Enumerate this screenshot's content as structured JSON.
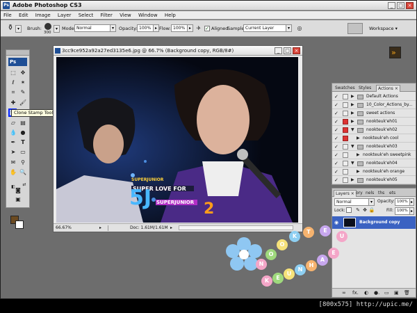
{
  "app": {
    "title": "Adobe Photoshop CS3",
    "logo": "Ps"
  },
  "window_controls": [
    "_",
    "□",
    "×"
  ],
  "menu": [
    "File",
    "Edit",
    "Image",
    "Layer",
    "Select",
    "Filter",
    "View",
    "Window",
    "Help"
  ],
  "options": {
    "brush_label": "Brush:",
    "brush_size": "300",
    "mode_label": "Mode:",
    "mode_value": "Normal",
    "opacity_label": "Opacity:",
    "opacity_value": "100%",
    "flow_label": "Flow:",
    "flow_value": "100%",
    "aligned_label": "Aligned",
    "sample_label": "Sample:",
    "sample_value": "Current Layer",
    "workspace_label": "Workspace ▾"
  },
  "toolbox": {
    "logo": "Ps",
    "tooltip": "Clone Stamp Tool (S)",
    "fg_color": "#6b4a21",
    "bg_color": "#ffffff"
  },
  "document": {
    "title": "3cc9ce952a92a27ed3135e6.jpg @ 66.7% (Background copy, RGB/8#)",
    "zoom": "66.67%",
    "doc_info": "Doc: 1.61M/1.61M",
    "image_text_1": "SUPER LOVE FOR",
    "image_text_2": "SUPERJUNIOR",
    "image_text_3": "SUPERJUNIOR",
    "image_logo": "5J",
    "image_number": "2"
  },
  "actions_panel": {
    "tabs": [
      "Swatches",
      "Styles",
      "Actions ×"
    ],
    "rows": [
      {
        "label": "Default Actions",
        "red": false,
        "expanded": false,
        "indent": 0
      },
      {
        "label": "10_Color_Actions_by...",
        "red": false,
        "expanded": false,
        "indent": 0
      },
      {
        "label": "sweet actions",
        "red": false,
        "expanded": false,
        "indent": 0
      },
      {
        "label": "nookteuk'eh01",
        "red": true,
        "expanded": false,
        "indent": 0
      },
      {
        "label": "nookteuk'eh02",
        "red": true,
        "expanded": true,
        "indent": 0
      },
      {
        "label": "nookteuk'eh cool",
        "red": true,
        "expanded": false,
        "indent": 1
      },
      {
        "label": "nookteuk'eh03",
        "red": false,
        "expanded": true,
        "indent": 0
      },
      {
        "label": "nookteuk'eh sweetpink",
        "red": false,
        "expanded": false,
        "indent": 1
      },
      {
        "label": "nookteuk'eh04",
        "red": false,
        "expanded": true,
        "indent": 0
      },
      {
        "label": "nookteuk'eh orange",
        "red": false,
        "expanded": false,
        "indent": 1
      },
      {
        "label": "nookteuk'eh05",
        "red": false,
        "expanded": false,
        "indent": 0
      }
    ]
  },
  "layers_panel": {
    "tabs": [
      "Layers ×",
      "ory",
      "nels",
      "ths",
      "ets"
    ],
    "blend_mode": "Normal",
    "opacity_label": "Opacity:",
    "opacity_value": "100%",
    "lock_label": "Lock:",
    "fill_label": "Fill:",
    "fill_value": "100%",
    "layer_name": "Background copy",
    "footer_icons": [
      "∞",
      "fx.",
      "◐",
      "●.",
      "▭",
      "▣",
      "🗑"
    ]
  },
  "decoration": {
    "letters": [
      "N",
      "O",
      "O",
      "K",
      "T",
      "E",
      "U",
      "K",
      "E",
      "U",
      "N",
      "H",
      "A",
      "E"
    ]
  },
  "watermark": "[800x575] http://upic.me/",
  "colors": {
    "accent": "#0022ff",
    "layer_selected": "#3b62c2",
    "doc_bg": "#6d6d6d"
  }
}
